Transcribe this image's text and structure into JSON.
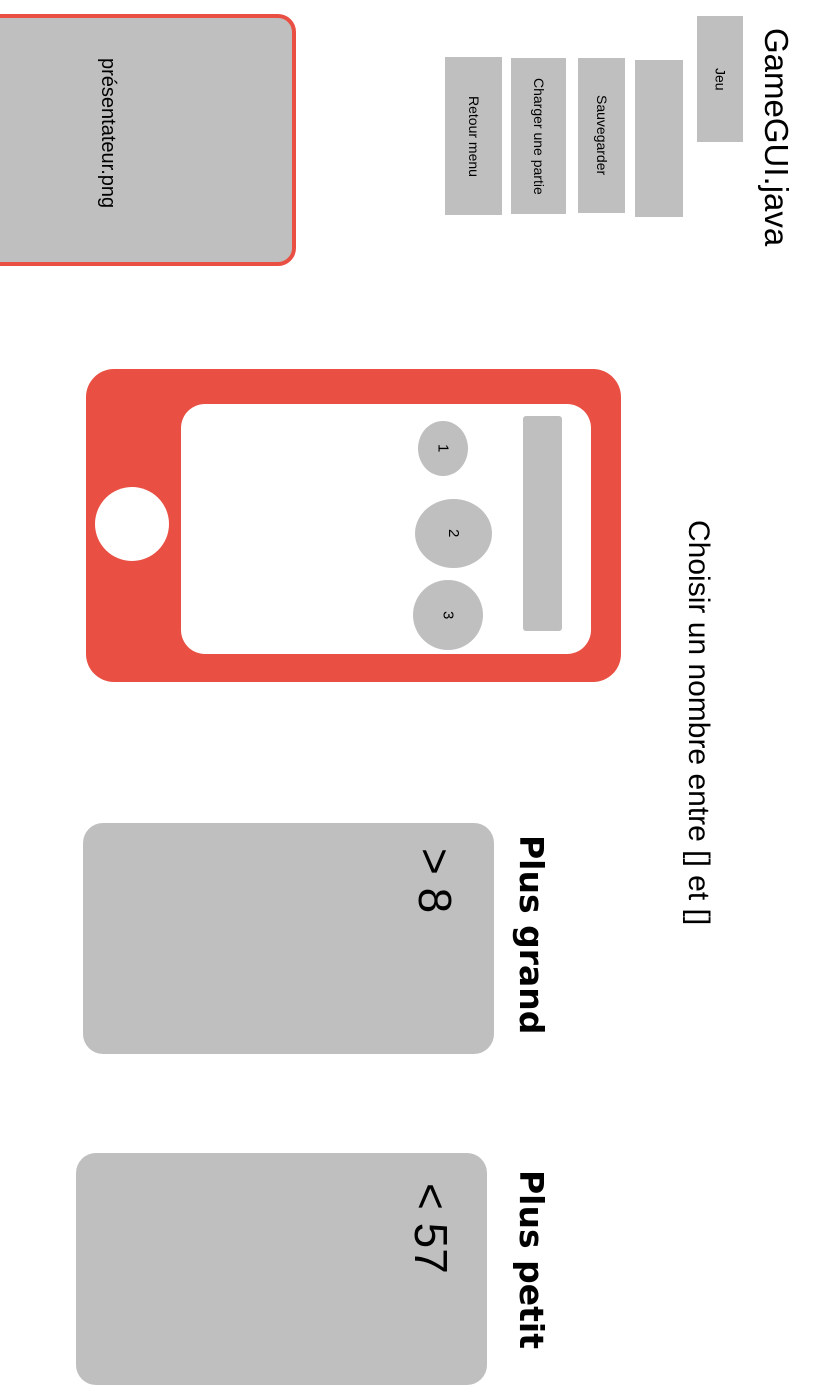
{
  "window": {
    "title": "GameGUI.java"
  },
  "menu": {
    "items": [
      {
        "label": "Jeu"
      },
      {
        "label": ""
      },
      {
        "label": "Sauvegarder"
      },
      {
        "label": "Charger une partie"
      },
      {
        "label": "Retour menu"
      }
    ]
  },
  "presenter": {
    "image_label": "présentateur.png"
  },
  "prompt": {
    "text": "Choisir un nombre entre [] et []"
  },
  "phone": {
    "input_value": "",
    "choices": [
      "1",
      "2",
      "3"
    ]
  },
  "hints": {
    "greater": {
      "label": "Plus grand",
      "value": "> 8"
    },
    "smaller": {
      "label": "Plus petit",
      "value": "< 57"
    }
  },
  "colors": {
    "accent_red": "#e94f42",
    "placeholder_gray": "#bfbfbf",
    "background": "#ffffff"
  }
}
